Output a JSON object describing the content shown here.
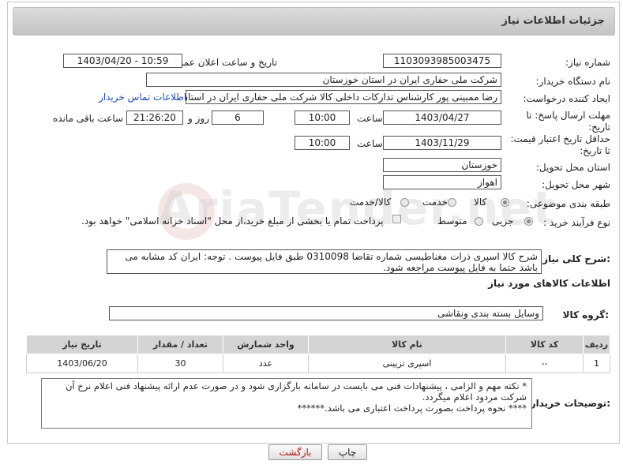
{
  "panel_title": "جزئیات اطلاعات نیاز",
  "fields": {
    "need_number_label": "شماره نیاز:",
    "need_number": "1103093985003475",
    "announce_label": "تاریخ و ساعت اعلان عمومی:",
    "announce_value": "1403/04/20 - 10:59",
    "buyer_org_label": "نام دستگاه خریدار:",
    "buyer_org": "شرکت ملی حفاری ایران در استان خوزستان",
    "requester_label": "ایجاد کننده درخواست:",
    "requester": "رضا ممبینی پور کارشناس تدارکات داخلی کالا شرکت ملی حفاری ایران در استان",
    "contact_link": "اطلاعات تماس خریدار",
    "deadline_label": "مهلت ارسال پاسخ: تا تاریخ:",
    "deadline_date": "1403/04/27",
    "time_label": "ساعت",
    "deadline_time": "10:00",
    "days_value": "6",
    "days_label": "روز و",
    "remaining_time": "21:26:20",
    "remaining_label": "ساعت باقی مانده",
    "min_validity_label": "حداقل تاریخ اعتبار قیمت: تا تاریخ:",
    "validity_date": "1403/11/29",
    "validity_time": "10:00",
    "province_label": "استان محل تحویل:",
    "province": "خوزستان",
    "city_label": "شهر محل تحویل:",
    "city": "اهواز",
    "category_label": "طبقه بندی موضوعی:",
    "category_options": [
      "کالا",
      "خدمت",
      "کالا/خدمت"
    ],
    "process_label": "نوع فرآیند خرید :",
    "process_options": [
      "جزیی",
      "متوسط"
    ],
    "payment_note": "پرداخت تمام یا بخشی از مبلغ خرید،از محل \"اسناد خزانه اسلامی\" خواهد بود."
  },
  "description": {
    "label": "شرح کلی نیاز:",
    "text": "شرح کالا     اسپری ذرات مغناطیسی  شماره تقاضا  0310098   طبق فایل پیوست . توجه: ایران کد مشابه می باشد حتما به فایل پیوست مراجعه شود."
  },
  "goods_section": {
    "title": "اطلاعات کالاهای مورد نیاز",
    "group_label": "گروه کالا:",
    "group_value": "وسایل بسته بندی  ونقاشی"
  },
  "table": {
    "headers": [
      "ردیف",
      "کد کالا",
      "نام کالا",
      "واحد شمارش",
      "تعداد / مقدار",
      "تاریخ نیاز"
    ],
    "rows": [
      [
        "1",
        "--",
        "اسپری تزیینی",
        "عدد",
        "30",
        "1403/06/20"
      ]
    ]
  },
  "buyer_notes": {
    "label": "توضیحات خریدار:",
    "line1": "*  نکته مهم و الزامی ، پیشنهادات فنی می بایست در سامانه بارگزاری شود و در صورت عدم ارائه پیشنهاد فنی اعلام نرخ آن شرکت مردود اعلام میگردد.",
    "line2": "****    نحوه پرداخت بصورت پرداخت اعتباری می باشد.******"
  },
  "buttons": {
    "print": "چاپ",
    "back": "بازگشت"
  },
  "watermark": "AriaTender.net"
}
